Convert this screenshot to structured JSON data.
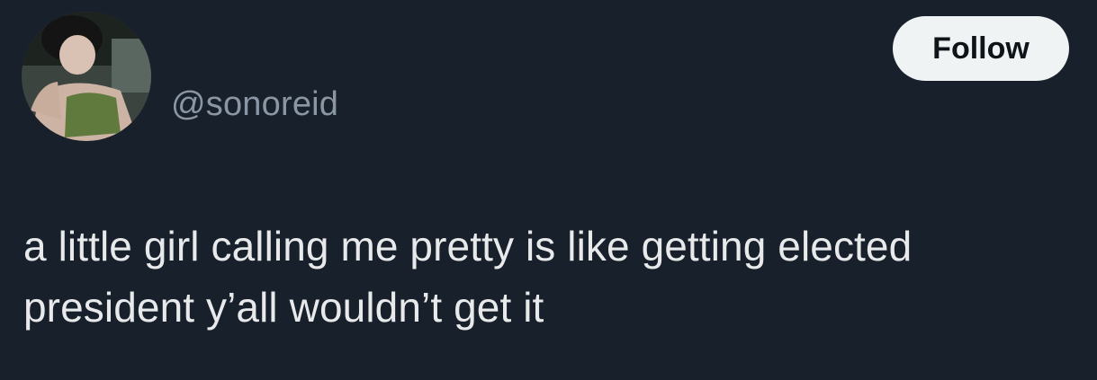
{
  "tweet": {
    "handle": "@sonoreid",
    "follow_label": "Follow",
    "text": "a little girl calling me pretty is like getting elected president y’all wouldn’t get it"
  },
  "colors": {
    "background": "#18202b",
    "text": "#e7e9ea",
    "secondary_text": "#8a96a3",
    "follow_button_bg": "#eff3f4",
    "follow_button_text": "#0f1419"
  }
}
